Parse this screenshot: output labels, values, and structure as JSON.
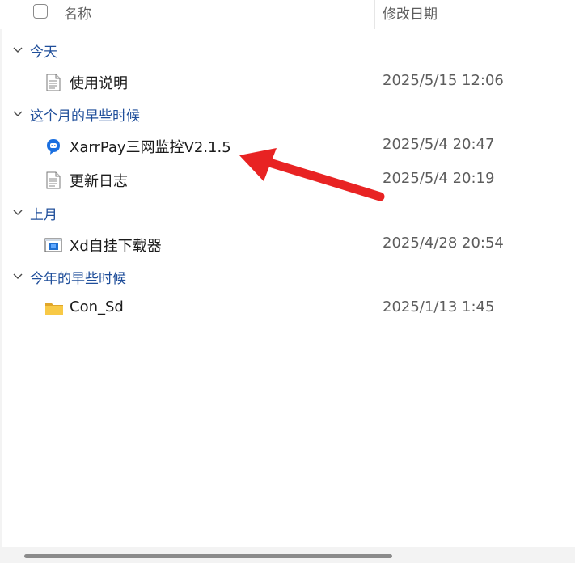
{
  "header": {
    "name_label": "名称",
    "date_label": "修改日期"
  },
  "groups": [
    {
      "label": "今天"
    },
    {
      "label": "这个月的早些时候"
    },
    {
      "label": "上月"
    },
    {
      "label": "今年的早些时候"
    }
  ],
  "files": [
    {
      "name": "使用说明",
      "date": "2025/5/15 12:06",
      "icon": "text-file-icon"
    },
    {
      "name": "XarrPay三网监控V2.1.5",
      "date": "2025/5/4 20:47",
      "icon": "app-icon"
    },
    {
      "name": "更新日志",
      "date": "2025/5/4 20:19",
      "icon": "text-file-icon"
    },
    {
      "name": "Xd自挂下载器",
      "date": "2025/4/28 20:54",
      "icon": "exe-icon"
    },
    {
      "name": "Con_Sd",
      "date": "2025/1/13 1:45",
      "icon": "folder-icon"
    }
  ],
  "colors": {
    "group_text": "#1f4e9a",
    "arrow": "#e82323",
    "folder": "#f8c946"
  }
}
